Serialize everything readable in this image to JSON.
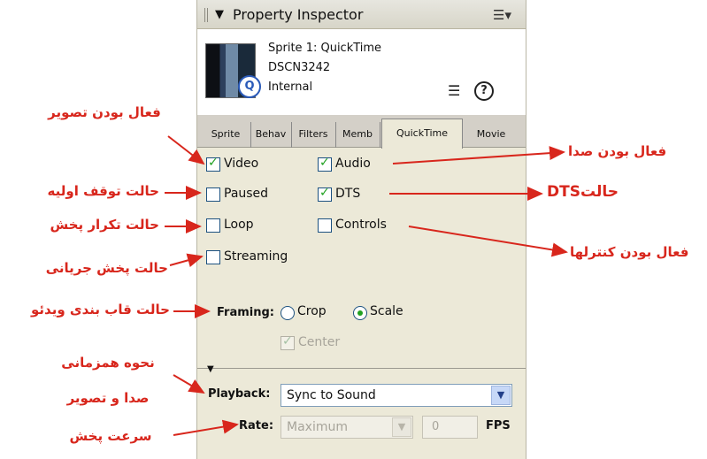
{
  "panel": {
    "title": "Property Inspector",
    "options_icon": "options-menu-icon",
    "sprite": {
      "name": "Sprite 1: QuickTime",
      "member": "DSCN3242",
      "cast": "Internal",
      "thumbnail_icon": "quicktime-icon"
    },
    "tabs": [
      "Sprite",
      "Behav",
      "Filters",
      "Memb",
      "QuickTime",
      "Movie"
    ],
    "active_tab": "QuickTime",
    "checkboxes": {
      "video": {
        "label": "Video",
        "checked": true
      },
      "audio": {
        "label": "Audio",
        "checked": true
      },
      "paused": {
        "label": "Paused",
        "checked": false
      },
      "dts": {
        "label": "DTS",
        "checked": true
      },
      "loop": {
        "label": "Loop",
        "checked": false
      },
      "controls": {
        "label": "Controls",
        "checked": false
      },
      "streaming": {
        "label": "Streaming",
        "checked": false
      },
      "center": {
        "label": "Center",
        "checked": true,
        "disabled": true
      }
    },
    "framing": {
      "label": "Framing:",
      "crop": "Crop",
      "scale": "Scale",
      "selected": "Scale"
    },
    "playback": {
      "label": "Playback:",
      "value": "Sync to Sound"
    },
    "rate": {
      "label": "Rate:",
      "value": "Maximum",
      "fps_value": "0",
      "fps_unit": "FPS"
    }
  },
  "annotations": {
    "video": "فعال بودن تصویر",
    "audio": "فعال بودن صدا",
    "paused": "حالت توقف اولیه",
    "dts": "حالتDTS",
    "loop": "حالت تکرار پخش",
    "controls": "فعال بودن کنترلها",
    "streaming": "حالت پخش جریانی",
    "framing": "حالت قاب بندی ویدئو",
    "playback_line1": "نحوه همزمانی",
    "playback_line2": "صدا و تصویر",
    "rate": "سرعت پخش"
  },
  "colors": {
    "annotation": "#d8261c",
    "check": "#21a121",
    "panel": "#ece9d8"
  }
}
